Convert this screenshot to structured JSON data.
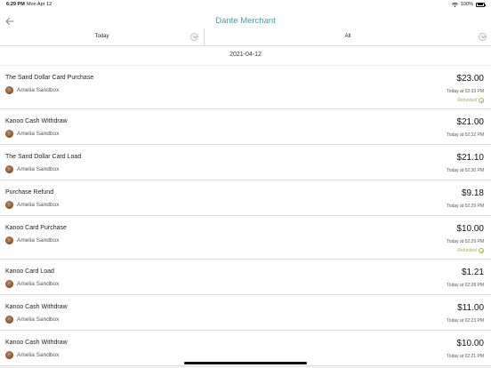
{
  "status_bar": {
    "time": "6:29 PM",
    "date": "Mon Apr 12",
    "battery": "100%"
  },
  "header": {
    "title": "Dante Merchant",
    "accent_color": "#2bb09a",
    "back_icon": "back-arrow-icon"
  },
  "filters": {
    "period": "Today",
    "type": "All"
  },
  "date_header": "2021-04-12",
  "transactions": [
    {
      "title": "The Sand Dollar Card Purchase",
      "user": "Amelia Sandbox",
      "amount": "$23.00",
      "time": "Today at 02:33 PM",
      "status": "Refunded"
    },
    {
      "title": "Kanoo Cash Withdraw",
      "user": "Amelia Sandbox",
      "amount": "$21.00",
      "time": "Today at 02:32 PM",
      "status": ""
    },
    {
      "title": "The Sand Dollar Card Load",
      "user": "Amelia Sandbox",
      "amount": "$21.10",
      "time": "Today at 02:30 PM",
      "status": ""
    },
    {
      "title": "Purchase Refund",
      "user": "Amelia Sandbox",
      "amount": "$9.18",
      "time": "Today at 02:29 PM",
      "status": ""
    },
    {
      "title": "Kanoo Card Purchase",
      "user": "Amelia Sandbox",
      "amount": "$10.00",
      "time": "Today at 02:29 PM",
      "status": "Refunded"
    },
    {
      "title": "Kanoo Card Load",
      "user": "Amelia Sandbox",
      "amount": "$1.21",
      "time": "Today at 02:28 PM",
      "status": ""
    },
    {
      "title": "Kanoo Cash Withdraw",
      "user": "Amelia Sandbox",
      "amount": "$11.00",
      "time": "Today at 02:23 PM",
      "status": ""
    },
    {
      "title": "Kanoo Cash Withdraw",
      "user": "Amelia Sandbox",
      "amount": "$10.00",
      "time": "Today at 02:21 PM",
      "status": ""
    }
  ]
}
